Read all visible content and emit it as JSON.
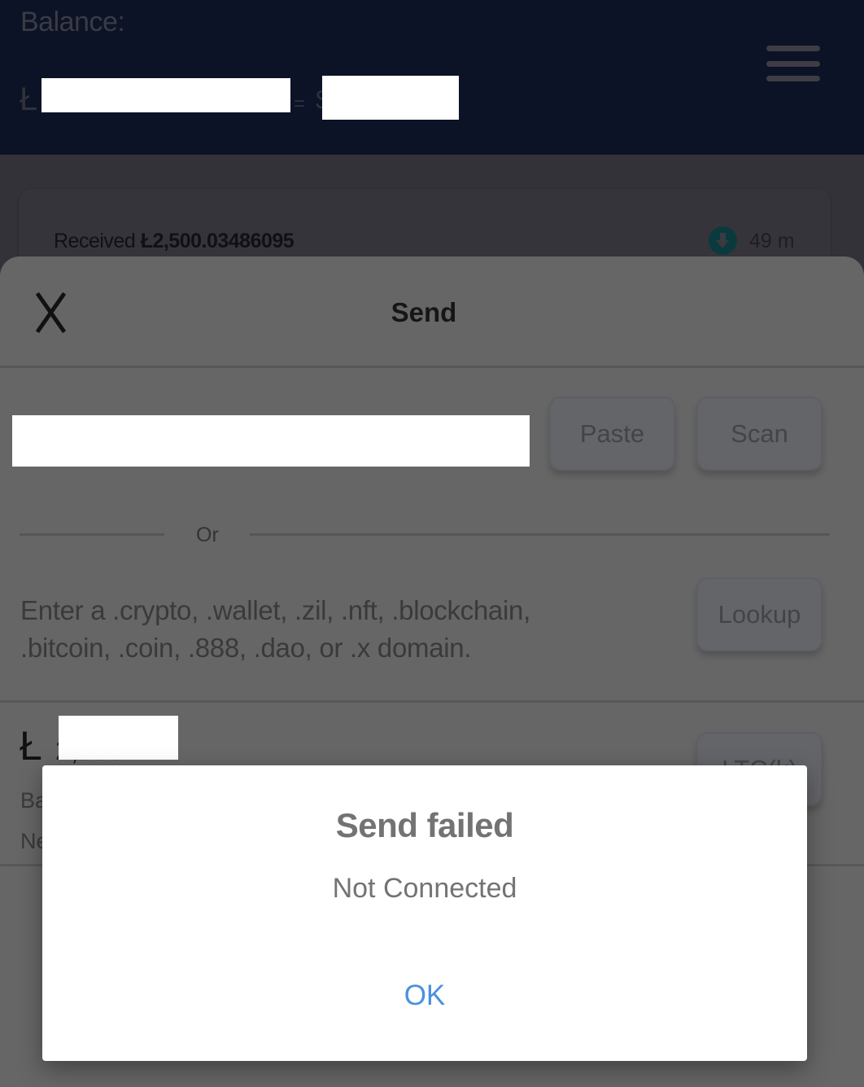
{
  "header": {
    "balance_label": "Balance:",
    "currency_symbol": "Ł",
    "equals": "=",
    "fiat_symbol": "$",
    "menu_icon": "hamburger-menu-icon"
  },
  "transaction": {
    "prefix": "Received",
    "amount": "Ł2,500.03486095",
    "direction_icon": "arrow-down-circle-icon",
    "time": "49 m"
  },
  "send_sheet": {
    "title": "Send",
    "close_icon": "close-icon",
    "address_input": {
      "value": "",
      "placeholder": ""
    },
    "paste_label": "Paste",
    "scan_label": "Scan",
    "or_label": "Or",
    "domain_hint": "Enter a .crypto, .wallet, .zil, .nft, .blockchain, .bitcoin, .coin, .888, .dao, or .x domain.",
    "lookup_label": "Lookup",
    "amount_symbol": "Ł",
    "amount_partial": "2,000",
    "unit_label": "LTC(k)",
    "balance_label_partial": "Ba",
    "network_label_partial": "Ne"
  },
  "alert": {
    "title": "Send failed",
    "message": "Not Connected",
    "ok_label": "OK",
    "ok_color": "#4a90e2"
  },
  "colors": {
    "header_bg": "#0c1326",
    "overlay_bg": "#666666",
    "dialog_bg": "#ffffff"
  }
}
